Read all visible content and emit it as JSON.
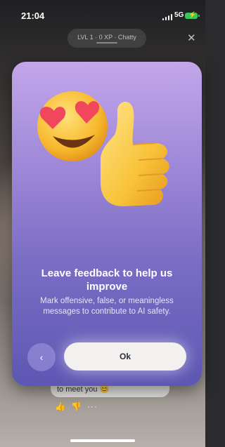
{
  "status_bar": {
    "time": "21:04",
    "network": "5G",
    "battery_charging": true
  },
  "header": {
    "level_pill": "LVL 1 · 0 XP · Chatty",
    "close_icon": "close-icon"
  },
  "modal": {
    "title": "Leave feedback to help us improve",
    "description": "Mark offensive, false, or meaningless messages to contribute to AI safety.",
    "illustration_icons": [
      "heart-eyes-emoji-icon",
      "thumbs-up-icon"
    ],
    "back_label": "‹",
    "ok_label": "Ok"
  },
  "background_chat": {
    "bubble_text": "to meet you 😊",
    "reactions": [
      "👍",
      "👎",
      "···"
    ]
  },
  "colors": {
    "card_top": "#c2a6ea",
    "card_bottom": "#5d57b3",
    "ok_button": "#f3f1f0",
    "battery": "#35c759"
  }
}
